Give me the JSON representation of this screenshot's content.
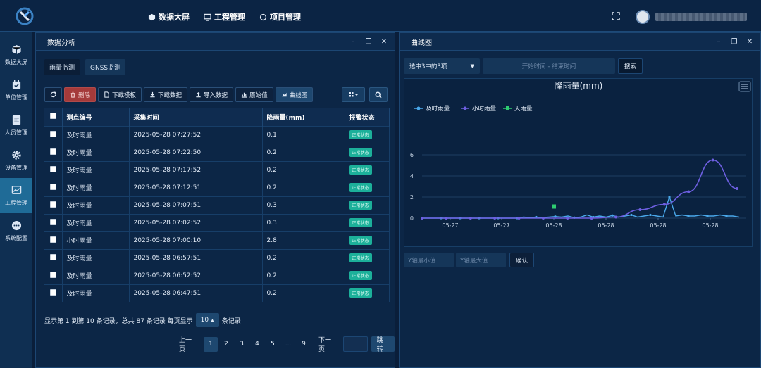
{
  "topnav": [
    {
      "label": "数据大屏",
      "icon": "cube-icon"
    },
    {
      "label": "工程管理",
      "icon": "monitor-icon"
    },
    {
      "label": "项目管理",
      "icon": "circle-icon"
    }
  ],
  "sidebar": [
    {
      "label": "数据大屏",
      "icon": "cube-icon"
    },
    {
      "label": "单位管理",
      "icon": "calendar-check-icon"
    },
    {
      "label": "人员管理",
      "icon": "id-card-icon"
    },
    {
      "label": "设备管理",
      "icon": "gear-icon"
    },
    {
      "label": "工程管理",
      "icon": "chart-icon",
      "active": true
    },
    {
      "label": "系统配置",
      "icon": "dots-icon"
    }
  ],
  "left_panel": {
    "title": "数据分析",
    "tabs": [
      "雨量监测",
      "GNSS监测"
    ],
    "toolbar": {
      "delete": "删除",
      "download_template": "下载模板",
      "download_data": "下载数据",
      "import_data": "导入数据",
      "raw_value": "原始值",
      "curve": "曲线图"
    },
    "table": {
      "headers": [
        "测点编号",
        "采集时间",
        "降雨量(mm)",
        "报警状态"
      ],
      "rows": [
        [
          "及时雨量",
          "2025-05-28 07:27:52",
          "0.1",
          "正常状态"
        ],
        [
          "及时雨量",
          "2025-05-28 07:22:50",
          "0.2",
          "正常状态"
        ],
        [
          "及时雨量",
          "2025-05-28 07:17:52",
          "0.2",
          "正常状态"
        ],
        [
          "及时雨量",
          "2025-05-28 07:12:51",
          "0.2",
          "正常状态"
        ],
        [
          "及时雨量",
          "2025-05-28 07:07:51",
          "0.3",
          "正常状态"
        ],
        [
          "及时雨量",
          "2025-05-28 07:02:52",
          "0.3",
          "正常状态"
        ],
        [
          "小时雨量",
          "2025-05-28 07:00:10",
          "2.8",
          "正常状态"
        ],
        [
          "及时雨量",
          "2025-05-28 06:57:51",
          "0.2",
          "正常状态"
        ],
        [
          "及时雨量",
          "2025-05-28 06:52:52",
          "0.2",
          "正常状态"
        ],
        [
          "及时雨量",
          "2025-05-28 06:47:51",
          "0.2",
          "正常状态"
        ]
      ]
    },
    "pagination": {
      "info_prefix": "显示第 1 到第 10 条记录，总共 87 条记录 每页显示",
      "page_size": "10",
      "info_suffix": "条记录",
      "prev": "上一页",
      "pages": [
        "1",
        "2",
        "3",
        "4",
        "5",
        "...",
        "9"
      ],
      "next": "下一页",
      "jump": "跳转"
    }
  },
  "right_panel": {
    "title": "曲线图",
    "select_label": "选中3中的3项",
    "date_placeholder": "开始时间 - 结束时间",
    "search": "搜索",
    "y_min_placeholder": "Y轴最小值",
    "y_max_placeholder": "Y轴最大值",
    "confirm": "确认"
  },
  "chart_data": {
    "type": "line",
    "title": "降雨量(mm)",
    "x_tick_labels": [
      "05-27",
      "05-27",
      "05-28",
      "05-28",
      "05-28",
      "05-28"
    ],
    "y_ticks": [
      0,
      2,
      4,
      6
    ],
    "ylim": [
      0,
      6
    ],
    "legend_position": "top-left",
    "grid": true,
    "series": [
      {
        "name": "及时雨量",
        "color": "#4aa8ea",
        "values": [
          0,
          0,
          0,
          0,
          0,
          0,
          0,
          0,
          0,
          0,
          0,
          0,
          0,
          0,
          0,
          0,
          0.1,
          0.05,
          0.1,
          0.05,
          0.1,
          0.15,
          0.1,
          0.2,
          0.05,
          0.1,
          0.3,
          0.1,
          0.2,
          0.1,
          0.25,
          0.1,
          0.2,
          0.3,
          0.1,
          0.2,
          0.3,
          0.2,
          0.1,
          2.0,
          0.2,
          0.3,
          0.2,
          0.2,
          0.3,
          0.2,
          0.2,
          0.3,
          0.2,
          0.2,
          0.1
        ]
      },
      {
        "name": "小时雨量",
        "color": "#6d5fe0",
        "values": [
          0,
          0,
          0,
          0,
          0,
          0,
          0,
          0,
          0.1,
          0.8,
          1.3,
          2.5,
          5.5,
          2.8
        ]
      },
      {
        "name": "天雨量",
        "color": "#2ecc71",
        "values": [
          1.1
        ]
      }
    ]
  }
}
